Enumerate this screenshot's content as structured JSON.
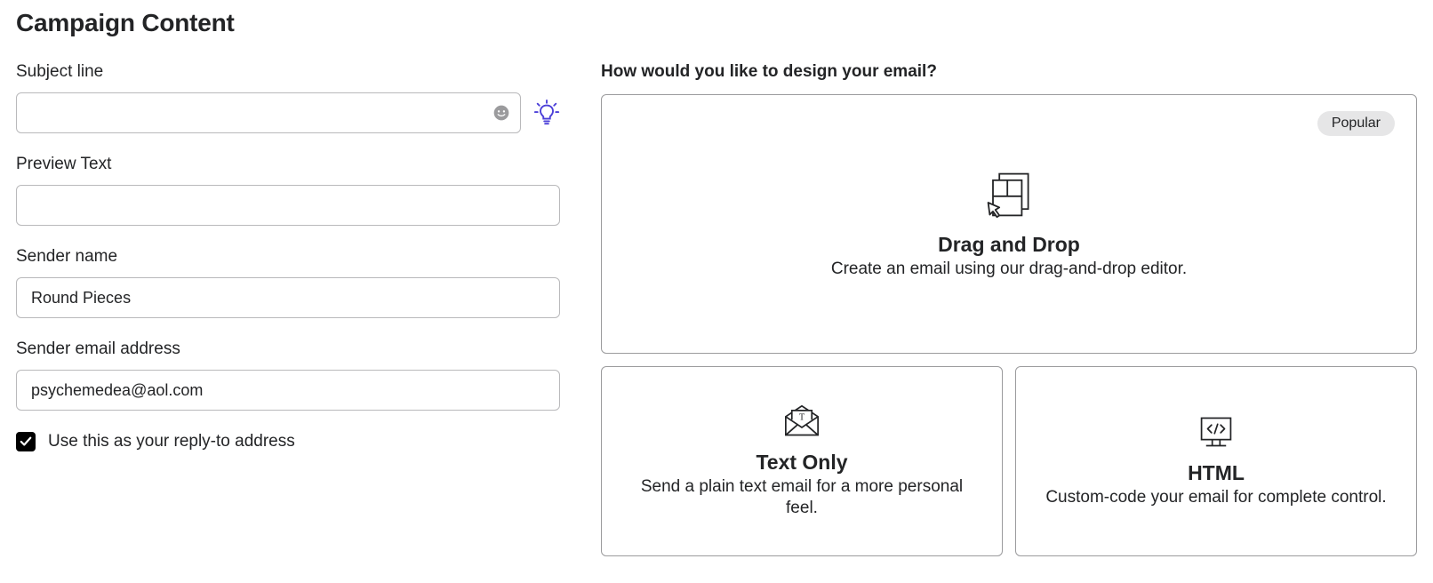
{
  "heading": "Campaign Content",
  "left": {
    "subject": {
      "label": "Subject line",
      "value": ""
    },
    "preview": {
      "label": "Preview Text",
      "value": ""
    },
    "sender_name": {
      "label": "Sender name",
      "value": "Round Pieces"
    },
    "sender_email": {
      "label": "Sender email address",
      "value": "psychemedea@aol.com"
    },
    "reply_to": {
      "label": "Use this as your reply-to address",
      "checked": true
    }
  },
  "right": {
    "prompt": "How would you like to design your email?",
    "drag_drop": {
      "badge": "Popular",
      "title": "Drag and Drop",
      "desc": "Create an email using our drag-and-drop editor."
    },
    "text_only": {
      "title": "Text Only",
      "desc": "Send a plain text email for a more personal feel."
    },
    "html": {
      "title": "HTML",
      "desc": "Custom-code your email for complete control."
    }
  }
}
